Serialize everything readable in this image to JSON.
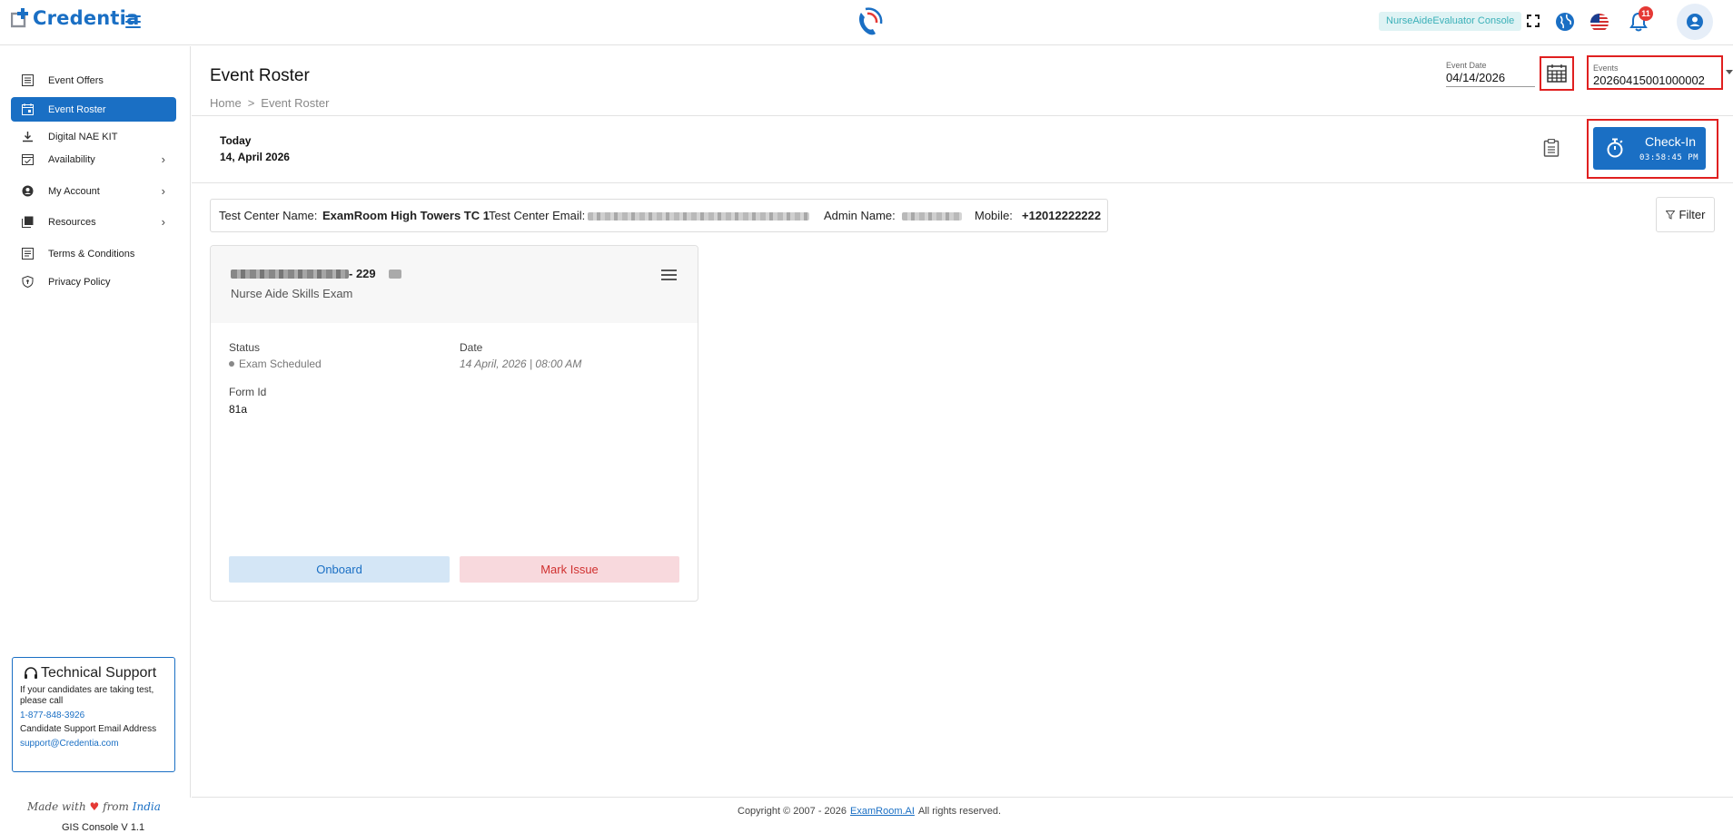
{
  "header": {
    "brand": "Credentia",
    "console_badge": "NurseAideEvaluator Console",
    "notification_count": "11"
  },
  "sidebar": {
    "items": [
      {
        "label": "Event Offers",
        "icon": "list-icon"
      },
      {
        "label": "Event Roster",
        "icon": "calendar-icon",
        "active": true
      },
      {
        "label": "Digital NAE KIT",
        "icon": "download-icon"
      },
      {
        "label": "Availability",
        "icon": "calendar-check-icon",
        "has_children": true
      },
      {
        "label": "My Account",
        "icon": "account-circle-icon",
        "has_children": true
      },
      {
        "label": "Resources",
        "icon": "library-icon",
        "has_children": true
      },
      {
        "label": "Terms & Conditions",
        "icon": "document-icon"
      },
      {
        "label": "Privacy Policy",
        "icon": "shield-icon"
      }
    ],
    "support": {
      "title": "Technical Support",
      "text1": "If your candidates are taking test, please call",
      "phone": "1-877-848-3926",
      "text2": "Candidate Support Email Address",
      "email": "support@Credentia.com"
    },
    "made_with_prefix": "Made with",
    "made_with_from": "from",
    "made_with_place": "India",
    "version": "GIS Console V 1.1"
  },
  "main": {
    "title": "Event Roster",
    "breadcrumb": {
      "home": "Home",
      "sep": ">",
      "current": "Event Roster"
    },
    "event_date": {
      "label": "Event Date",
      "value": "04/14/2026"
    },
    "events": {
      "label": "Events",
      "value": "20260415001000002"
    },
    "today_label": "Today",
    "today_date": "14, April 2026",
    "checkin": {
      "label": "Check-In",
      "time": "03:58:45 PM"
    },
    "info": {
      "center_name_label": "Test Center Name:",
      "center_name": "ExamRoom High Towers TC 1",
      "center_email_label": "Test Center Email:",
      "admin_label": "Admin Name:",
      "mobile_label": "Mobile:",
      "mobile": "+12012222222"
    },
    "filter_label": "Filter",
    "card": {
      "id_prefix": "- 229",
      "exam": "Nurse Aide Skills Exam",
      "status_label": "Status",
      "status_value": "Exam Scheduled",
      "date_label": "Date",
      "date_value": "14 April, 2026 | 08:00 AM",
      "form_label": "Form Id",
      "form_value": "81a",
      "onboard_label": "Onboard",
      "issue_label": "Mark Issue"
    }
  },
  "footer": {
    "prefix": "Copyright © 2007 - 2026",
    "link": "ExamRoom.AI",
    "suffix": "All rights reserved."
  },
  "colors": {
    "brand": "#1a6fc4",
    "highlight": "#e02020",
    "badge_bg": "#dff3f4",
    "danger_bg": "#f8d9dd"
  }
}
